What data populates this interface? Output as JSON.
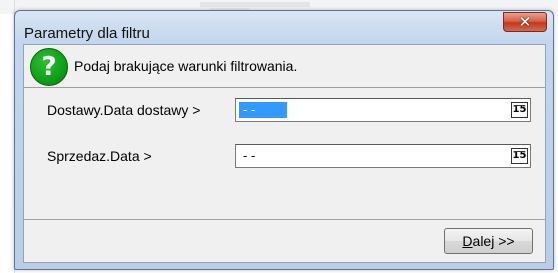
{
  "window": {
    "title": "Parametry dla filtru",
    "close_glyph": "✕",
    "close_icon": "close-icon"
  },
  "header": {
    "icon": "question-icon",
    "icon_glyph": "?",
    "prompt": "Podaj brakujące warunki filtrowania."
  },
  "fields": [
    {
      "label": "Dostawy.Data dostawy >",
      "value": " - -",
      "focused": true,
      "calendar_glyph": "15"
    },
    {
      "label": "Sprzedaz.Data >",
      "value": " - -",
      "focused": false,
      "calendar_glyph": "15"
    }
  ],
  "buttons": {
    "next_mnemonic": "D",
    "next_rest": "alej >>"
  },
  "colors": {
    "selection": "#3399ff",
    "icon_green": "#10a21a",
    "close_red": "#c0391f"
  }
}
